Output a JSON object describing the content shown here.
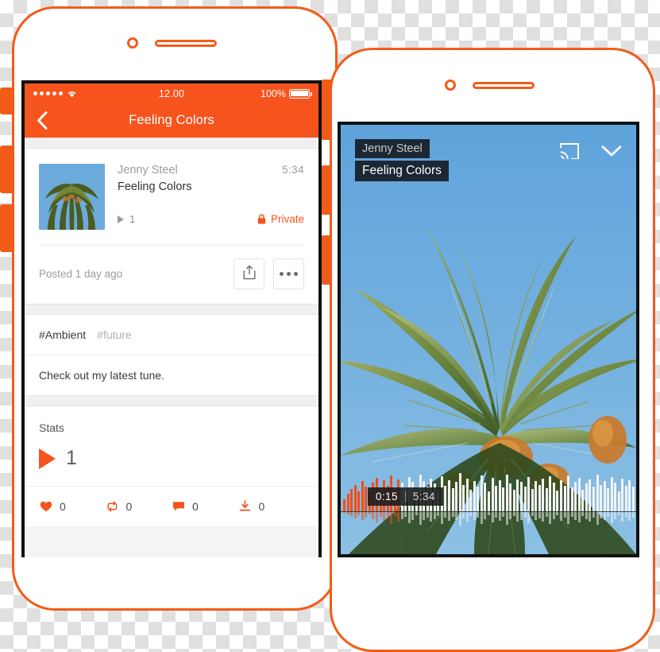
{
  "meta": {
    "accent_orange": "#f7531d",
    "frame_orange": "#f25c19",
    "canvas_bg": "transparent-checkerboard"
  },
  "left_phone": {
    "status_bar": {
      "signal_dots": 5,
      "wifi_icon": "wifi-icon",
      "time": "12.00",
      "battery_percent": "100%",
      "battery_icon": "battery-full-icon"
    },
    "nav": {
      "back_icon": "chevron-left-icon",
      "title": "Feeling Colors"
    },
    "track": {
      "artwork_alt": "palm-tree-artwork",
      "username": "Jenny Steel",
      "duration": "5:34",
      "title": "Feeling Colors",
      "play_icon": "play-icon",
      "play_count": "1",
      "privacy_icon": "lock-icon",
      "privacy_label": "Private"
    },
    "post": {
      "posted_label": "Posted 1 day ago",
      "share_icon": "share-icon",
      "more_icon": "more-dots-icon"
    },
    "tags": [
      {
        "label": "#Ambient",
        "style": "dark"
      },
      {
        "label": "#future",
        "style": "muted"
      }
    ],
    "description": "Check out my latest tune.",
    "stats": {
      "heading": "Stats",
      "plays_icon": "play-icon",
      "plays_value": "1",
      "counters": [
        {
          "icon": "heart-icon",
          "value": "0"
        },
        {
          "icon": "repost-icon",
          "value": "0"
        },
        {
          "icon": "comment-icon",
          "value": "0"
        },
        {
          "icon": "download-icon",
          "value": "0"
        }
      ]
    }
  },
  "right_phone": {
    "video": {
      "username": "Jenny Steel",
      "title": "Feeling Colors",
      "cast_icon": "cast-icon",
      "collapse_icon": "chevron-down-icon",
      "elapsed": "0:15",
      "total": "5:34",
      "progress_percent": 19
    },
    "waveform": {
      "bar_count": 82,
      "played_color": "#f04e18",
      "remaining_color": "#f2f2f2",
      "heights": [
        28,
        40,
        52,
        62,
        46,
        70,
        58,
        44,
        66,
        78,
        54,
        72,
        60,
        84,
        50,
        74,
        66,
        56,
        80,
        68,
        48,
        86,
        70,
        58,
        76,
        64,
        52,
        82,
        60,
        72,
        54,
        68,
        88,
        62,
        76,
        50,
        70,
        58,
        84,
        66,
        46,
        78,
        60,
        72,
        56,
        86,
        64,
        50,
        74,
        68,
        58,
        80,
        52,
        70,
        62,
        76,
        54,
        82,
        66,
        48,
        72,
        60,
        84,
        56,
        68,
        78,
        50,
        64,
        74,
        58,
        86,
        62,
        70,
        54,
        80,
        66,
        46,
        76,
        60,
        72,
        58,
        68
      ]
    }
  }
}
